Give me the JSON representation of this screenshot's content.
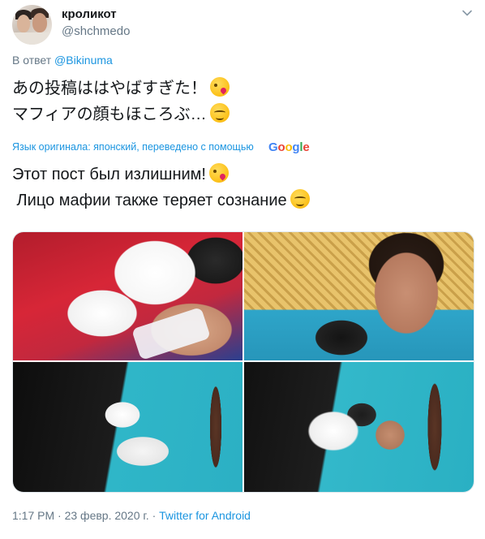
{
  "tweet": {
    "author": {
      "name": "кроликот",
      "handle": "@shchmedo"
    },
    "reply": {
      "prefix": "В ответ",
      "to": "@Bikinuma"
    },
    "original_text": {
      "line1": "あの投稿ははやばすぎた！",
      "line2": "マフィアの顔もほころぶ…"
    },
    "translation": {
      "notice": "Язык оригинала: японский, переведено с помощью",
      "provider_logo": "Google",
      "line1": "Этот пост был излишним!",
      "line2": " Лицо мафии также теряет сознание"
    },
    "emojis": {
      "line1": "face-throwing-kiss",
      "line2": "relieved-face"
    },
    "media": {
      "count": 4
    },
    "footer": {
      "time": "1:17 PM",
      "separator": " · ",
      "date": "23 февр. 2020 г.",
      "via": "Twitter for Android"
    }
  },
  "colors": {
    "link": "#1b95e0",
    "secondary_text": "#657786",
    "primary_text": "#14171a"
  }
}
